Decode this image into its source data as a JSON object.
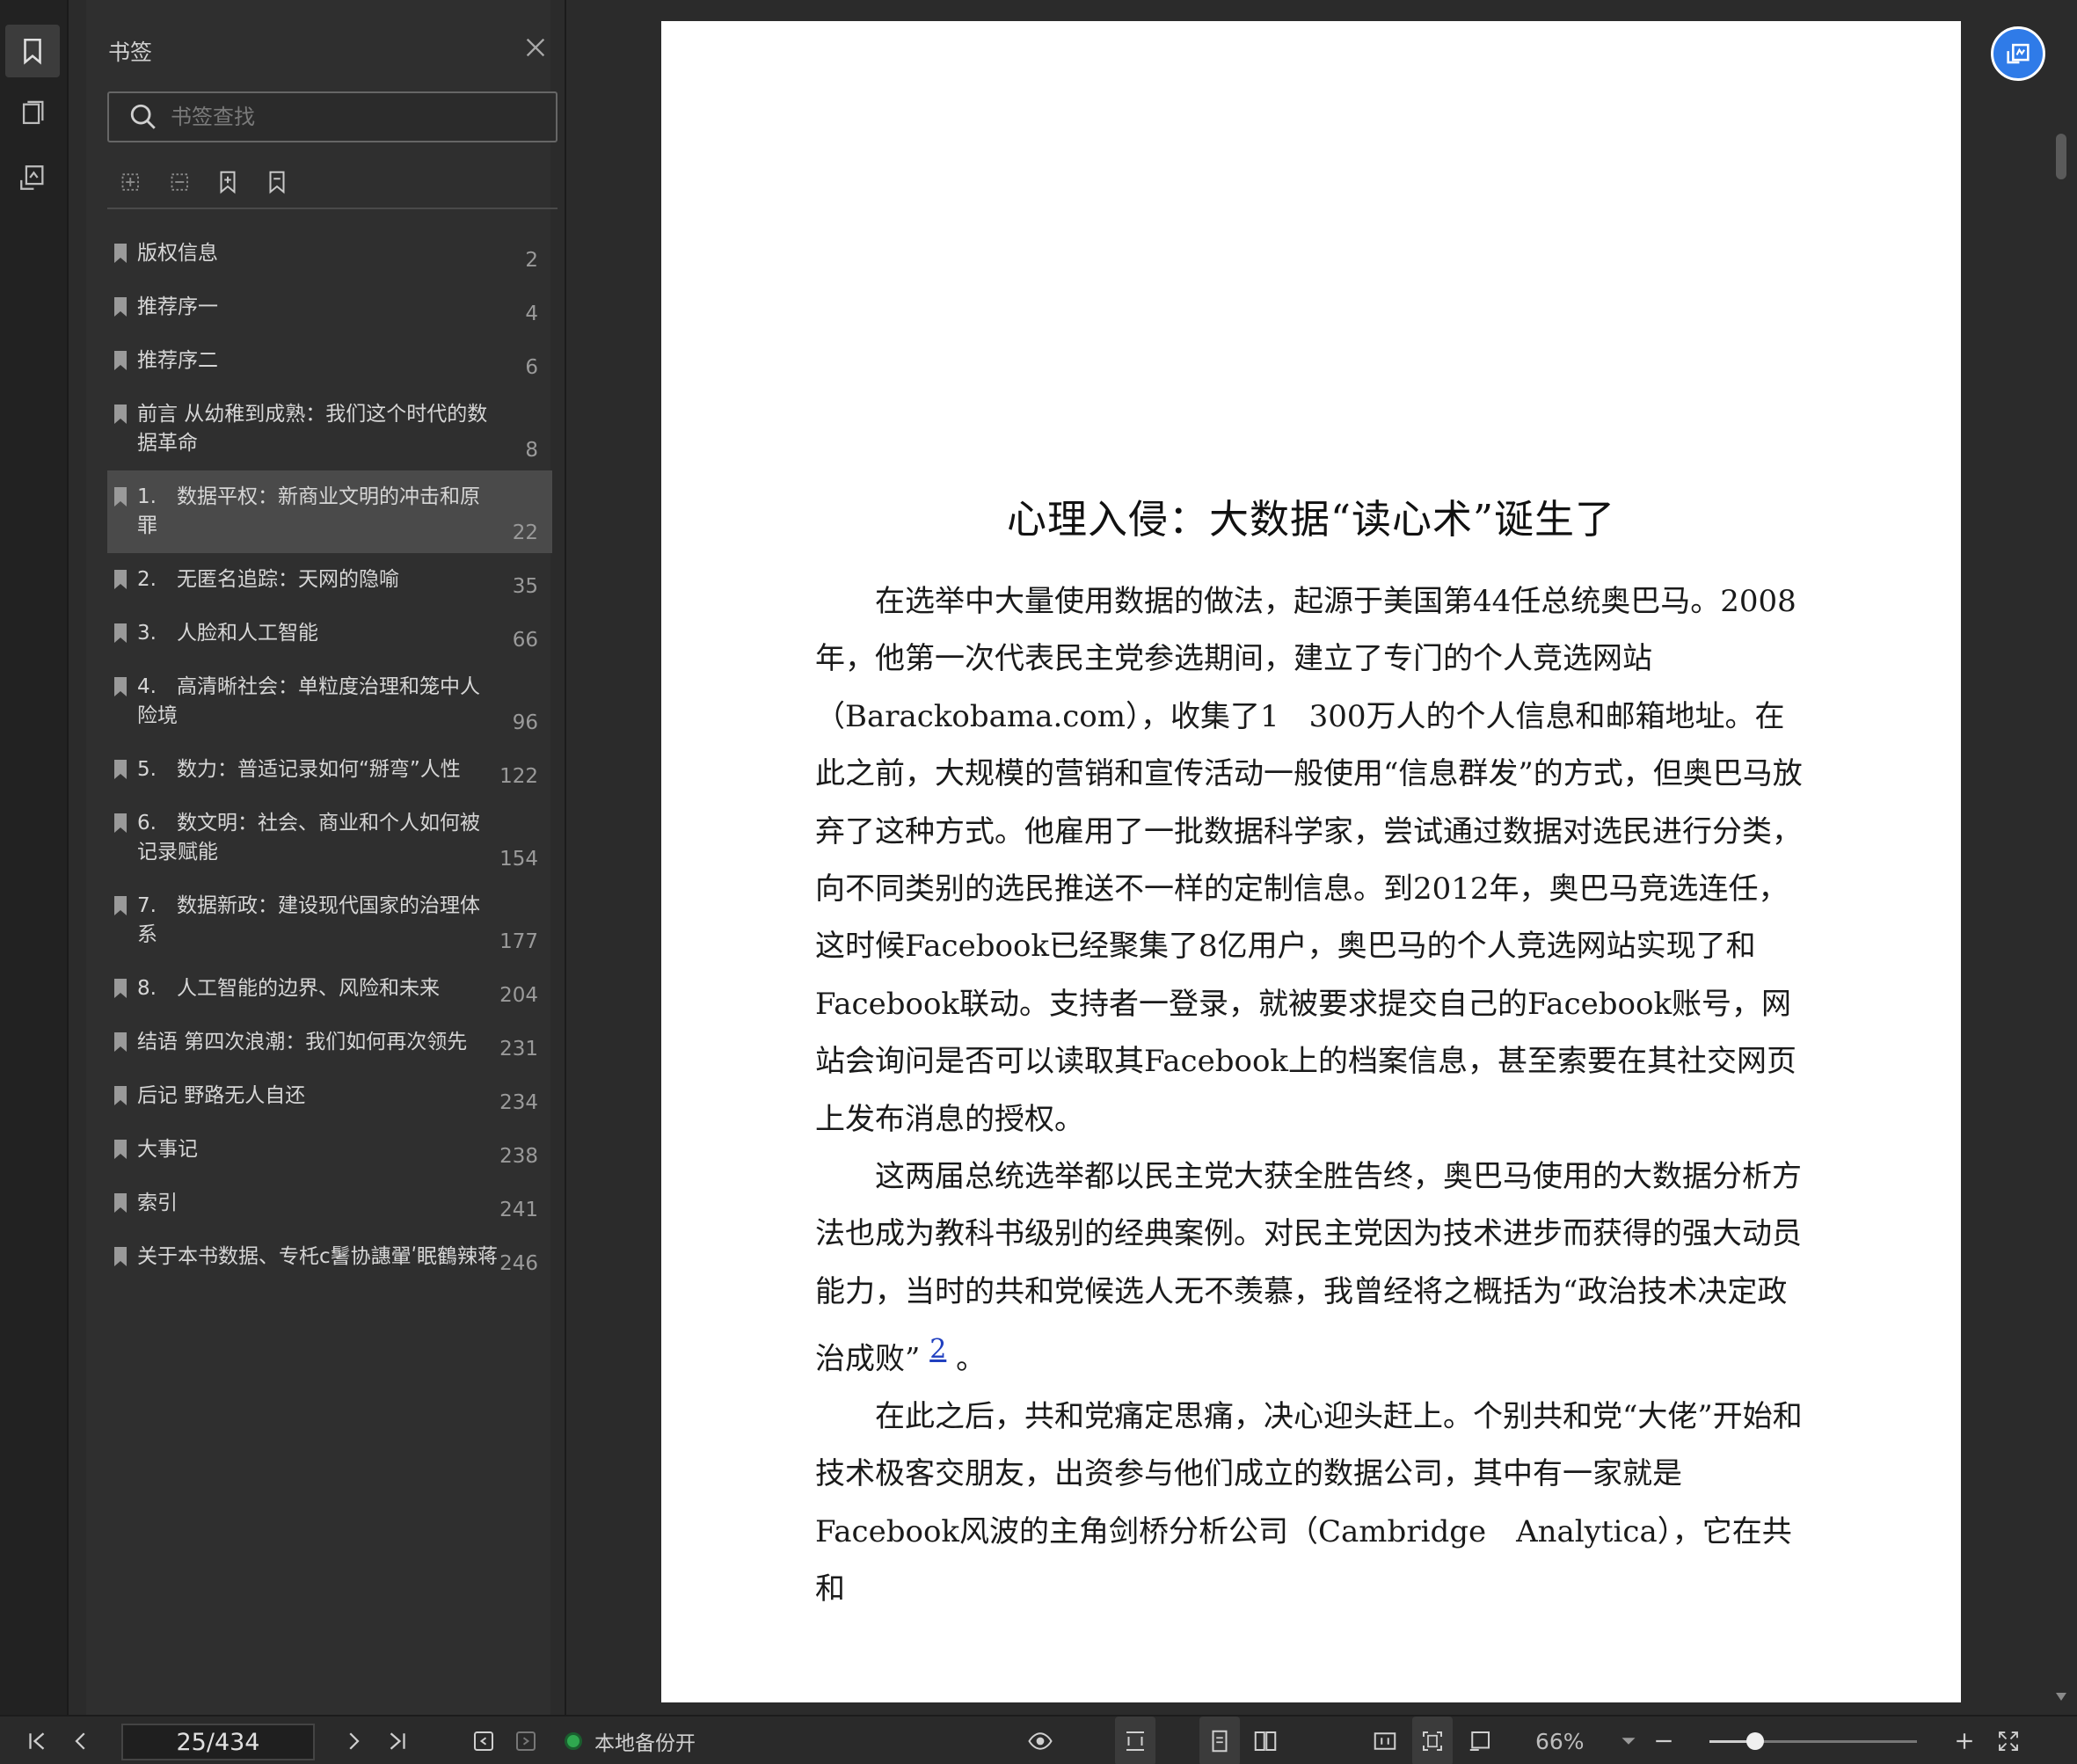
{
  "sidebar": {
    "title": "书签",
    "search_placeholder": "书签查找",
    "bookmarks": [
      {
        "label": "版权信息",
        "page": "2"
      },
      {
        "label": "推荐序一",
        "page": "4"
      },
      {
        "label": "推荐序二",
        "page": "6"
      },
      {
        "label": "前言 从幼稚到成熟：我们这个时代的数据革命",
        "page": "8"
      },
      {
        "label": "1.　数据平权：新商业文明的冲击和原罪",
        "page": "22",
        "selected": true
      },
      {
        "label": "2.　无匿名追踪：天网的隐喻",
        "page": "35"
      },
      {
        "label": "3.　人脸和人工智能",
        "page": "66"
      },
      {
        "label": "4.　高清晰社会：单粒度治理和笼中人险境",
        "page": "96"
      },
      {
        "label": "5.　数力：普适记录如何“掰弯”人性",
        "page": "122"
      },
      {
        "label": "6.　数文明：社会、商业和个人如何被记录赋能",
        "page": "154"
      },
      {
        "label": "7.　数据新政：建设现代国家的治理体系",
        "page": "177"
      },
      {
        "label": "8.　人工智能的边界、风险和未来",
        "page": "204"
      },
      {
        "label": "结语 第四次浪潮：我们如何再次领先",
        "page": "231"
      },
      {
        "label": "后记 野路无人自还",
        "page": "234"
      },
      {
        "label": "大事记",
        "page": "238"
      },
      {
        "label": "索引",
        "page": "241"
      },
      {
        "label": "关于本书数据、专杔c鬐协譓翬ʹ眠鶴辣蒋",
        "page": "246"
      }
    ]
  },
  "document": {
    "chapter_title": "心理入侵：大数据“读心术”诞生了",
    "paragraphs": [
      "在选举中大量使用数据的做法，起源于美国第44任总统奥巴马。2008年，他第一次代表民主党参选期间，建立了专门的个人竞选网站（Barackobama.com），收集了1　300万人的个人信息和邮箱地址。在此之前，大规模的营销和宣传活动一般使用“信息群发”的方式，但奥巴马放弃了这种方式。他雇用了一批数据科学家，尝试通过数据对选民进行分类，向不同类别的选民推送不一样的定制信息。到2012年，奥巴马竞选连任，这时候Facebook已经聚集了8亿用户，奥巴马的个人竞选网站实现了和Facebook联动。支持者一登录，就被要求提交自己的Facebook账号，网站会询问是否可以读取其Facebook上的档案信息，甚至索要在其社交网页上发布消息的授权。",
      "这两届总统选举都以民主党大获全胜告终，奥巴马使用的大数据分析方法也成为教科书级别的经典案例。对民主党因为技术进步而获得的强大动员能力，当时的共和党候选人无不羡慕，我曾经将之概括为“政治技术决定政治成败”",
      "在此之后，共和党痛定思痛，决心迎头赶上。个别共和党“大佬”开始和技术极客交朋友，出资参与他们成立的数据公司，其中有一家就是Facebook风波的主角剑桥分析公司（Cambridge　Analytica），它在共和"
    ],
    "footnote_ref": "2",
    "footnote_tail": "。"
  },
  "statusbar": {
    "page_indicator": "25/434",
    "backup_label": "本地备份开",
    "zoom_level": "66%",
    "zoom_fraction": 0.22
  },
  "colors": {
    "accent": "#2f7be8",
    "status_ok": "#2fa84f"
  }
}
